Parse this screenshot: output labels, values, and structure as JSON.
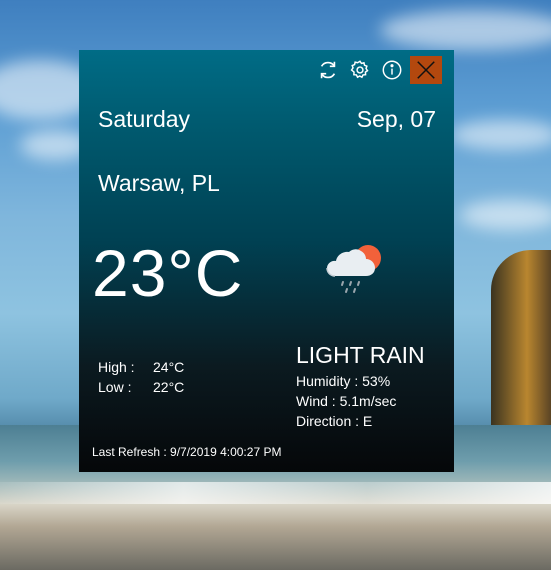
{
  "toolbar": {
    "refresh_icon": "refresh-icon",
    "settings_icon": "gear-icon",
    "info_icon": "info-icon",
    "close_icon": "close-icon",
    "close_color": "#b3480e"
  },
  "header": {
    "day": "Saturday",
    "date": "Sep, 07"
  },
  "location": "Warsaw, PL",
  "current": {
    "temperature": "23°C",
    "condition_icon": "rain-cloud-sun-icon"
  },
  "range": {
    "high_label": "High :",
    "high_value": "24°C",
    "low_label": "Low :",
    "low_value": "22°C"
  },
  "conditions": {
    "title": "LIGHT RAIN",
    "humidity": "Humidity : 53%",
    "wind": "Wind : 5.1m/sec",
    "direction": "Direction : E"
  },
  "footer": {
    "last_refresh": "Last Refresh : 9/7/2019 4:00:27 PM"
  }
}
